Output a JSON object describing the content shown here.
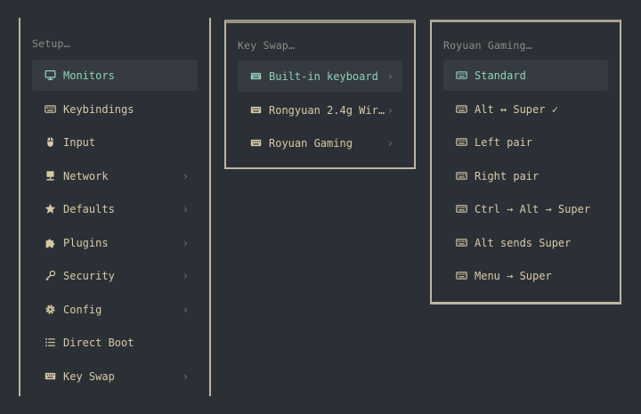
{
  "setup": {
    "title": "Setup…",
    "items": [
      {
        "label": "Monitors",
        "icon": "monitor-icon",
        "chevron": ""
      },
      {
        "label": "Keybindings",
        "icon": "keyboard-icon",
        "chevron": ""
      },
      {
        "label": "Input",
        "icon": "mouse-icon",
        "chevron": ""
      },
      {
        "label": "Network",
        "icon": "network-icon",
        "chevron": "›"
      },
      {
        "label": "Defaults",
        "icon": "star-icon",
        "chevron": "›"
      },
      {
        "label": "Plugins",
        "icon": "puzzle-icon",
        "chevron": "›"
      },
      {
        "label": "Security",
        "icon": "key-icon",
        "chevron": "›"
      },
      {
        "label": "Config",
        "icon": "gear-icon",
        "chevron": "›"
      },
      {
        "label": "Direct Boot",
        "icon": "list-icon",
        "chevron": ""
      },
      {
        "label": "Key Swap",
        "icon": "keyboard-icon",
        "chevron": "›"
      }
    ]
  },
  "keyswap": {
    "title": "Key Swap…",
    "items": [
      {
        "label": "Built-in keyboard",
        "icon": "keyboard-icon",
        "chevron": "›"
      },
      {
        "label": "Rongyuan 2.4g Wir…",
        "icon": "keyboard-icon",
        "chevron": "›"
      },
      {
        "label": "Royuan Gaming",
        "icon": "keyboard-icon",
        "chevron": "›"
      }
    ]
  },
  "royuan": {
    "title": "Royuan Gaming…",
    "items": [
      {
        "label": "Standard",
        "icon": "keyboard-icon"
      },
      {
        "label": "Alt ↔ Super ✓",
        "icon": "keyboard-icon"
      },
      {
        "label": "Left pair",
        "icon": "keyboard-icon"
      },
      {
        "label": "Right pair",
        "icon": "keyboard-icon"
      },
      {
        "label": "Ctrl → Alt → Super",
        "icon": "keyboard-icon"
      },
      {
        "label": "Alt sends Super",
        "icon": "keyboard-icon"
      },
      {
        "label": "Menu → Super",
        "icon": "keyboard-icon"
      }
    ]
  },
  "colors": {
    "background": "#2b3036",
    "selected_bg": "#353b40",
    "accent": "#8fd1bd",
    "text": "#d8c9a6",
    "muted": "#8d8e88",
    "border": "#bdb6a4"
  }
}
